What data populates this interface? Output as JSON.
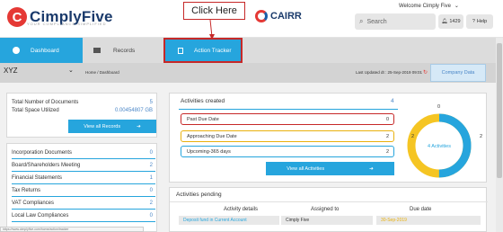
{
  "header": {
    "brand": {
      "initial": "C",
      "name": "CimplyFive",
      "tagline": "YOUR COMPLIANCE SIMPLIFIED"
    },
    "cairr": "CAIRR",
    "welcome": "Welcome Cimply  Five",
    "search_placeholder": "Search",
    "notifications_count": "1429",
    "help_label": "Help"
  },
  "callout": {
    "label": "Click Here"
  },
  "nav": {
    "tabs": [
      {
        "label": "Dashboard",
        "active": true
      },
      {
        "label": "Records",
        "active": false
      },
      {
        "label": "Action Tracker",
        "active": true
      }
    ]
  },
  "subbar": {
    "company": "XYZ",
    "breadcrumb": "Home  /  Dashboard",
    "last_updated": "Last Updated dt : 25-Sep-2019 09:01",
    "company_data_button": "Company Data"
  },
  "documents": {
    "total_docs_label": "Total Number of Documents",
    "total_docs_value": "5",
    "total_space_label": "Total Space Utilized",
    "total_space_value": "0.00454807 GB",
    "view_all_label": "View all Records"
  },
  "categories": [
    {
      "label": "Incorporation Documents",
      "value": "0"
    },
    {
      "label": "Board/Shareholders Meeting",
      "value": "2"
    },
    {
      "label": "Financial Statements",
      "value": "1"
    },
    {
      "label": "Tax Returns",
      "value": "0"
    },
    {
      "label": "VAT Compliances",
      "value": "2"
    },
    {
      "label": "Local Law Compliances",
      "value": "0"
    }
  ],
  "activities": {
    "title": "Activities created",
    "count": "4",
    "rows": [
      {
        "label": "Past Due Date",
        "value": "0",
        "color": "#c62828"
      },
      {
        "label": "Approaching Due Date",
        "value": "2",
        "color": "#e9b10f"
      },
      {
        "label": "Upcoming-365 days",
        "value": "2",
        "color": "#26a5dd"
      }
    ],
    "view_all_label": "View all Activities",
    "donut": {
      "center_label": "4 Activities",
      "top_value": "0",
      "left_value": "2",
      "right_value": "2",
      "segments": [
        {
          "value": 2,
          "color": "#f5c523"
        },
        {
          "value": 2,
          "color": "#26a5dd"
        }
      ]
    }
  },
  "pending": {
    "title": "Activities pending",
    "columns": [
      "Activity details",
      "Assigned to",
      "Due date"
    ],
    "rows": [
      {
        "activity": "Deposit fund in Current Account",
        "assigned": "Cimply Five",
        "due": "30-Sep-2019"
      }
    ]
  },
  "statusbar": "https://www.cimplyfive.com/home/action/tracker",
  "colors": {
    "accent": "#26a5dd",
    "brand_red": "#e53935",
    "highlight": "#c62828"
  }
}
